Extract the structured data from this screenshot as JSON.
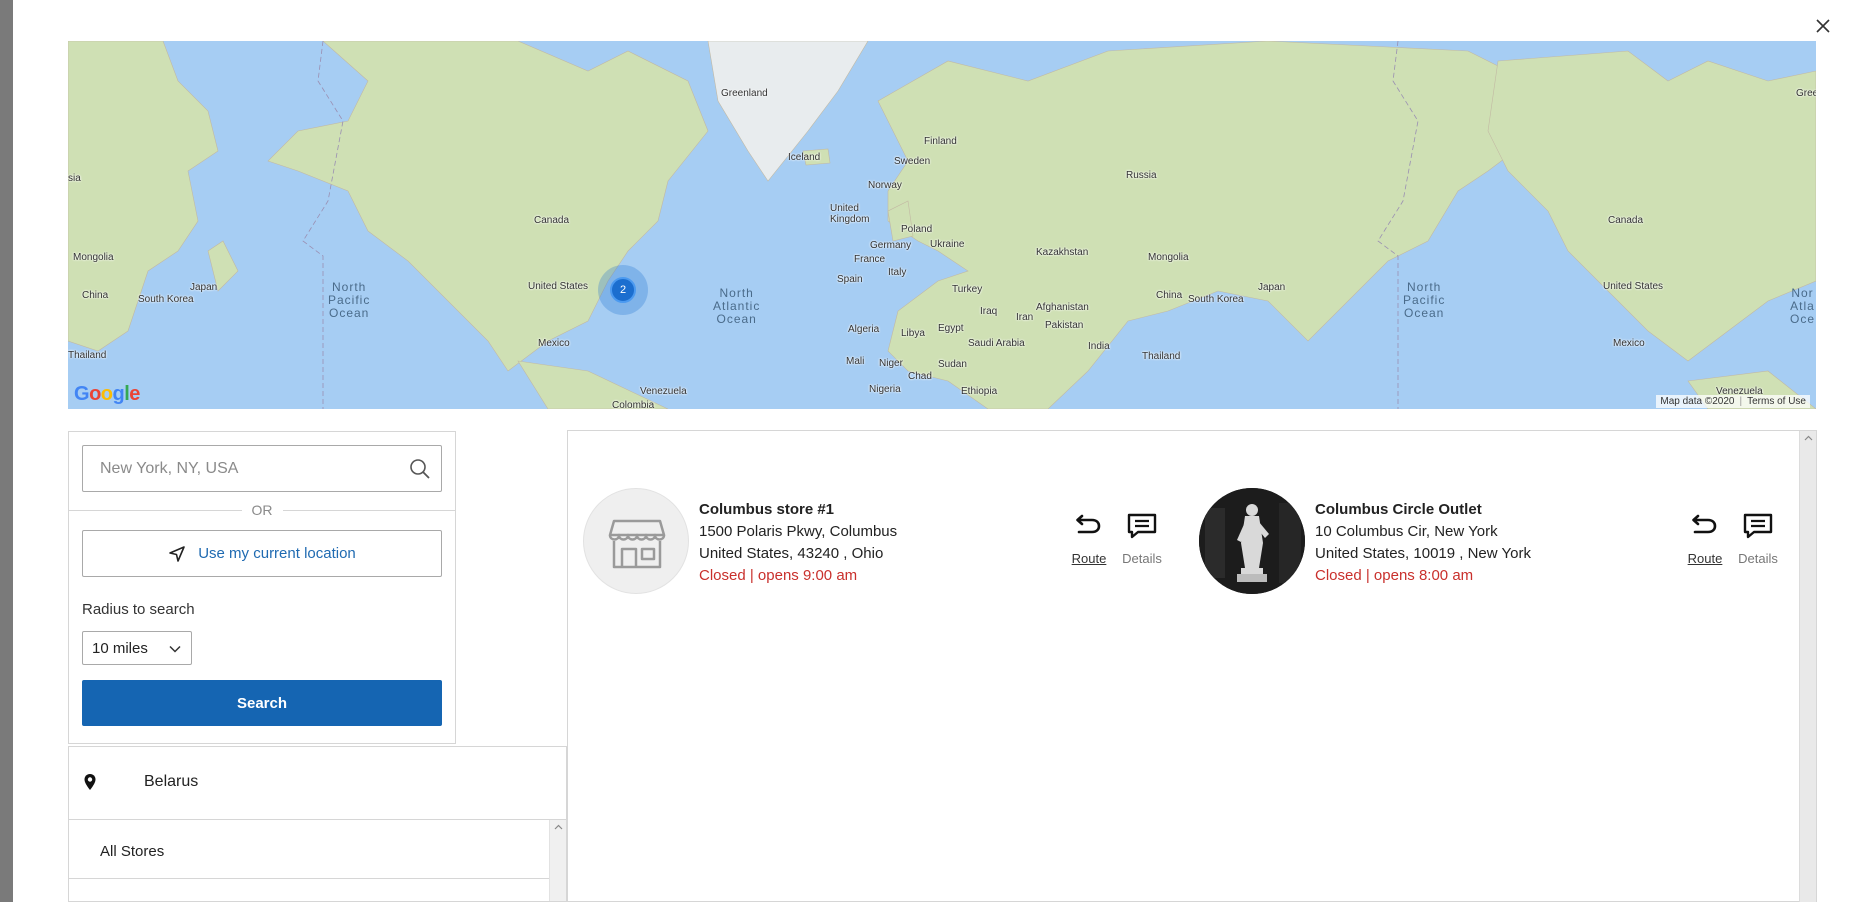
{
  "map": {
    "ocean_labels": [
      {
        "key": "np1",
        "text": "North\nPacific\nOcean"
      },
      {
        "key": "na1",
        "text": "North\nAtlantic\nOcean"
      },
      {
        "key": "np2",
        "text": "North\nPacific\nOcean"
      },
      {
        "key": "na2",
        "text": "Nor\nAtla\nOce"
      }
    ],
    "country_labels": [
      "Greenland",
      "Iceland",
      "Finland",
      "Sweden",
      "Norway",
      "United Kingdom",
      "Poland",
      "Germany",
      "Ukraine",
      "France",
      "Italy",
      "Spain",
      "Turkey",
      "Russia",
      "Kazakhstan",
      "Mongolia",
      "China",
      "Japan",
      "South Korea",
      "Iraq",
      "Iran",
      "Afghanistan",
      "Pakistan",
      "India",
      "Thailand",
      "Algeria",
      "Libya",
      "Egypt",
      "Saudi Arabia",
      "Mali",
      "Niger",
      "Chad",
      "Sudan",
      "Nigeria",
      "Ethiopia",
      "Canada",
      "United States",
      "Mexico",
      "Venezuela",
      "Colombia",
      "sia",
      "Mongolia",
      "China",
      "Japan",
      "South Korea",
      "Thailand",
      "Canada",
      "United States",
      "Mexico",
      "Venezuela",
      "Greer"
    ],
    "cluster_count": "2",
    "google_letters": [
      "G",
      "o",
      "o",
      "g",
      "l",
      "e"
    ],
    "google_colors": [
      "#4285F4",
      "#EA4335",
      "#FBBC05",
      "#4285F4",
      "#34A853",
      "#EA4335"
    ],
    "attribution": "Map data ©2020",
    "terms": "Terms of Use"
  },
  "search": {
    "placeholder": "New York, NY, USA",
    "value": "",
    "or_text": "OR",
    "use_location_label": "Use my current location",
    "radius_label": "Radius to search",
    "radius_value": "10 miles",
    "search_label": "Search"
  },
  "filter": {
    "country": "Belarus",
    "all_stores": "All Stores"
  },
  "stores": [
    {
      "name": "Columbus store #1",
      "address_line1": "1500 Polaris Pkwy, Columbus",
      "address_line2": "United States, 43240 , Ohio",
      "status": "Closed | opens 9:00 am",
      "route_label": "Route",
      "details_label": "Details",
      "thumb": "store-icon"
    },
    {
      "name": "Columbus Circle Outlet",
      "address_line1": "10 Columbus Cir, New York",
      "address_line2": "United States, 10019 , New York",
      "status": "Closed | opens 8:00 am",
      "route_label": "Route",
      "details_label": "Details",
      "thumb": "statue-photo"
    }
  ],
  "colors": {
    "primary_button": "#1565b2",
    "link": "#1f6ab1",
    "status_closed": "#c9302c",
    "map_water": "#a6cdf3",
    "cluster": "#1b6ecf"
  }
}
